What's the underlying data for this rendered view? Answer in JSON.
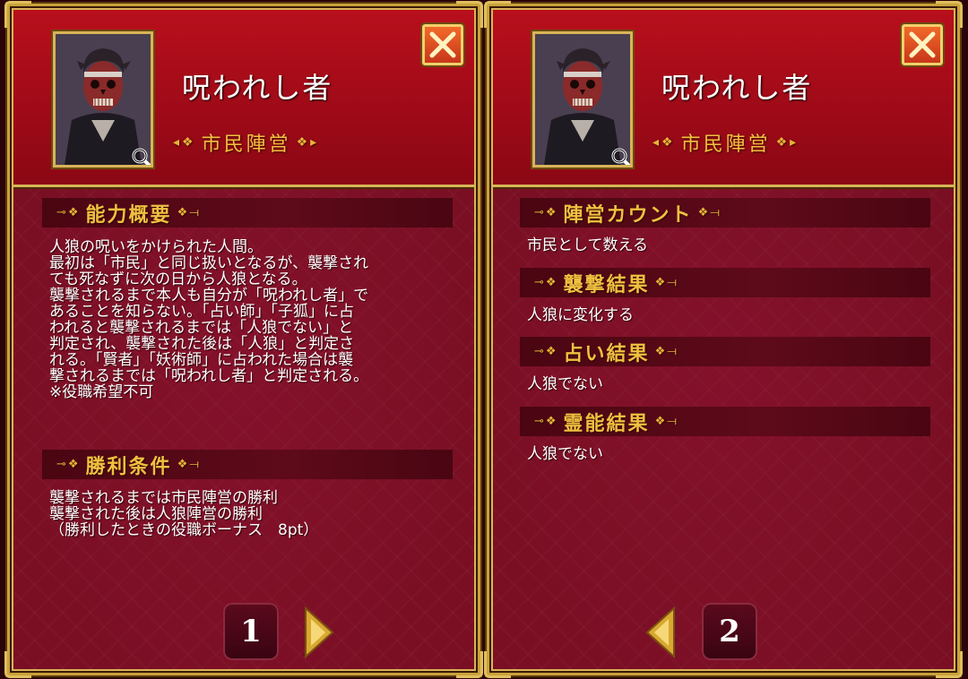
{
  "panels": [
    {
      "role_name": "呪われし者",
      "faction": "市民陣営",
      "sections": [
        {
          "title": "能力概要",
          "text": "人狼の呪いをかけられた人間。\n最初は「市民」と同じ扱いとなるが、襲撃され\nても死なずに次の日から人狼となる。\n襲撃されるまで本人も自分が「呪われし者」で\nあることを知らない。「占い師」「子狐」に占\nわれると襲撃されるまでは「人狼でない」と\n判定され、襲撃された後は「人狼」と判定さ\nれる。「賢者」「妖術師」に占われた場合は襲\n撃されるまでは「呪われし者」と判定される。\n※役職希望不可"
        },
        {
          "title": "勝利条件",
          "text": "襲撃されるまでは市民陣営の勝利\n襲撃された後は人狼陣営の勝利\n（勝利したときの役職ボーナス　8pt）"
        }
      ],
      "page": "1",
      "colors": {
        "close_bg": "#e2521f"
      }
    },
    {
      "role_name": "呪われし者",
      "faction": "市民陣営",
      "sections": [
        {
          "title": "陣営カウント",
          "text": "市民として数える"
        },
        {
          "title": "襲撃結果",
          "text": "人狼に変化する"
        },
        {
          "title": "占い結果",
          "text": "人狼でない"
        },
        {
          "title": "霊能結果",
          "text": "人狼でない"
        }
      ],
      "page": "2"
    }
  ],
  "icons": {
    "close": "close-x-icon",
    "zoom": "magnifier-icon",
    "next": "right-arrow-icon",
    "prev": "left-arrow-icon",
    "deco": "arrow-ornament-icon"
  },
  "colors": {
    "gold": "#f0c040",
    "panel_bg": "#7a0f24",
    "header_bg": "#b80f1c"
  }
}
